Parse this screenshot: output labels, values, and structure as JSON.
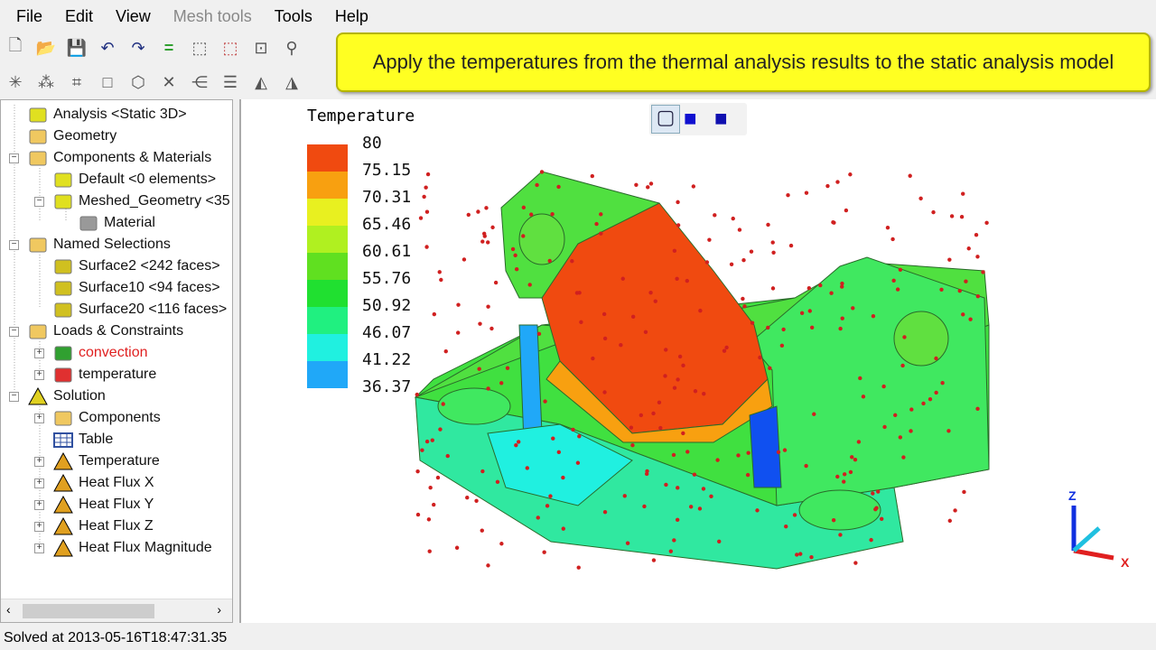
{
  "menu": [
    "File",
    "Edit",
    "View",
    "Mesh tools",
    "Tools",
    "Help"
  ],
  "callout": "Apply the temperatures from the thermal analysis results to the static analysis model",
  "tree": [
    {
      "label": "Analysis <Static 3D>",
      "icon": "analysis-icon"
    },
    {
      "label": "Geometry",
      "icon": "folder-icon"
    },
    {
      "label": "Components & Materials",
      "icon": "components-folder-icon"
    },
    {
      "label": "Default <0 elements>",
      "icon": "component-icon"
    },
    {
      "label": "Meshed_Geometry <35",
      "icon": "component-icon"
    },
    {
      "label": "Material",
      "icon": "material-icon"
    },
    {
      "label": "Named Selections",
      "icon": "selections-folder-icon"
    },
    {
      "label": "Surface2 <242 faces>",
      "icon": "faces-icon"
    },
    {
      "label": "Surface10 <94 faces>",
      "icon": "faces-icon"
    },
    {
      "label": "Surface20 <116 faces>",
      "icon": "faces-icon"
    },
    {
      "label": "Loads & Constraints",
      "icon": "loads-folder-icon"
    },
    {
      "label": "convection",
      "icon": "convection-icon",
      "color": "#e02020"
    },
    {
      "label": "temperature",
      "icon": "thermometer-icon"
    },
    {
      "label": "Solution",
      "icon": "solution-icon"
    },
    {
      "label": "Components",
      "icon": "components-folder-icon"
    },
    {
      "label": "Table",
      "icon": "table-icon"
    },
    {
      "label": "Temperature",
      "icon": "result-icon"
    },
    {
      "label": "Heat Flux X",
      "icon": "result-icon"
    },
    {
      "label": "Heat Flux Y",
      "icon": "result-icon"
    },
    {
      "label": "Heat Flux Z",
      "icon": "result-icon"
    },
    {
      "label": "Heat Flux Magnitude",
      "icon": "result-icon"
    }
  ],
  "legend": {
    "title": "Temperature",
    "values": [
      "80",
      "75.15",
      "70.31",
      "65.46",
      "60.61",
      "55.76",
      "50.92",
      "46.07",
      "41.22",
      "36.37"
    ],
    "colors": [
      "#f04a10",
      "#f8a010",
      "#e8f020",
      "#b0f020",
      "#60e020",
      "#20e030",
      "#20f080",
      "#20f0e0",
      "#20a8f8",
      "#1050f0"
    ]
  },
  "triad": {
    "z": "Z",
    "x": "X"
  },
  "status": "Solved at 2013-05-16T18:47:31.35"
}
